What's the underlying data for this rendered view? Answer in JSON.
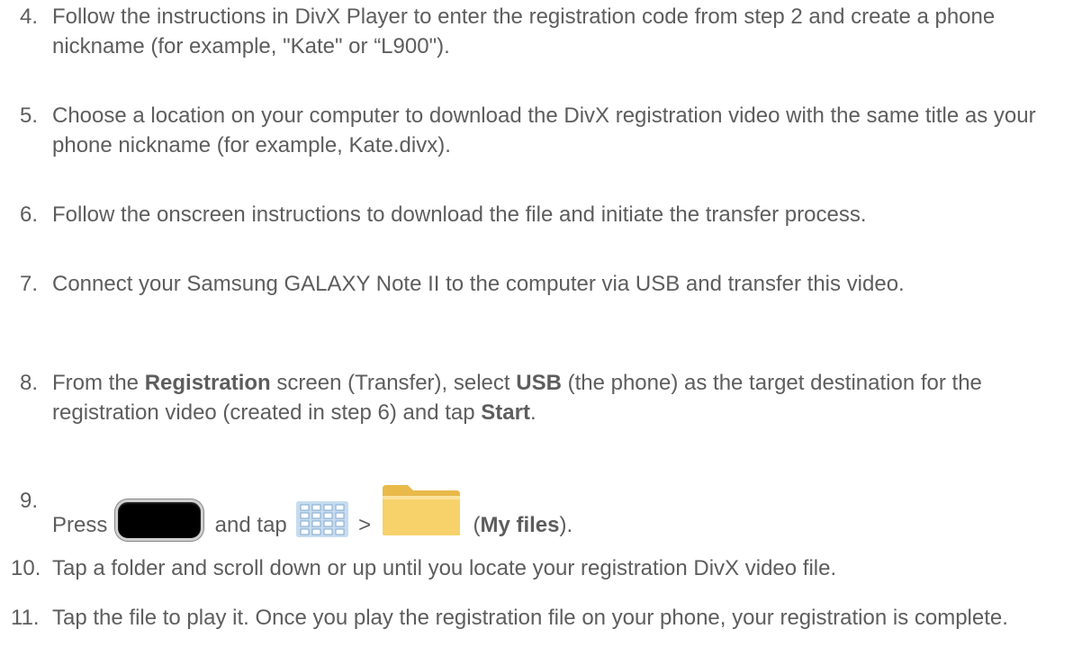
{
  "steps": [
    {
      "number": "4.",
      "text": "Follow the instructions in DivX Player to enter the registration code from step 2 and create a phone nickname (for example, \"Kate\" or “L900\")."
    },
    {
      "number": "5.",
      "text": "Choose a location on your computer to download the DivX registration video with the same title as your phone nickname (for example, Kate.divx)."
    },
    {
      "number": "6.",
      "text": "Follow the onscreen instructions to download the file and initiate the transfer process."
    },
    {
      "number": "7.",
      "text": "Connect your Samsung GALAXY Note II to the computer via USB and transfer this video."
    },
    {
      "number": "8.",
      "part1": "From the ",
      "bold1": "Registration",
      "part2": " screen (Transfer), select ",
      "bold2": "USB",
      "part3": " (the phone) as the target destination for the registration video (created in step 6) and tap ",
      "bold3": "Start",
      "part4": "."
    },
    {
      "number": "9.",
      "part1": "Press ",
      "part2": " and tap ",
      "part3": " > ",
      "part4": " (",
      "bold1": "My files",
      "part5": ")."
    },
    {
      "number": "10.",
      "text": "Tap a folder and scroll down or up until you locate your registration DivX video file."
    },
    {
      "number": "11.",
      "text": "Tap the file to play it. Once you play the registration file on your phone, your registration is complete."
    }
  ],
  "icons": {
    "home_key": "home-key-icon",
    "apps": "apps-icon",
    "my_files": "folder-icon"
  },
  "colors": {
    "text": "#5d5d5d",
    "folder": "#f7d26b"
  }
}
